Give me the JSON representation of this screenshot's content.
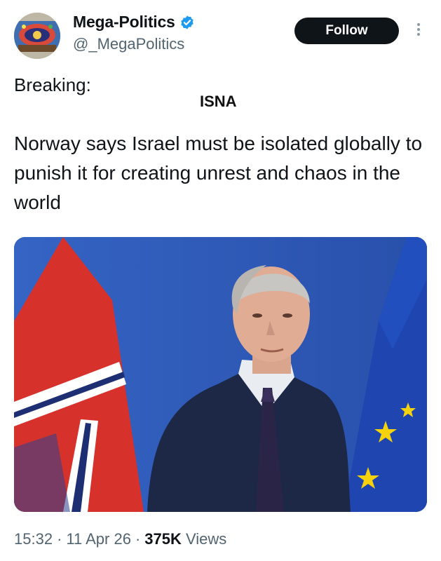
{
  "account": {
    "display_name": "Mega-Politics",
    "handle": "@_MegaPolitics"
  },
  "follow_label": "Follow",
  "tweet": {
    "prefix": "Breaking:",
    "source": "ISNA",
    "body": "Norway says Israel must be isolated globally to punish it for creating unrest and chaos in the world"
  },
  "meta": {
    "time": "15:32",
    "sep1": "·",
    "date": "11 Apr 26",
    "sep2": "·",
    "views_count": "375K",
    "views_label": "Views"
  },
  "colors": {
    "verified_badge": "#1d9bf0",
    "follow_bg": "#0f1419",
    "secondary_text": "#536471"
  },
  "icons": [
    "verified-badge-icon",
    "more-options-icon"
  ]
}
